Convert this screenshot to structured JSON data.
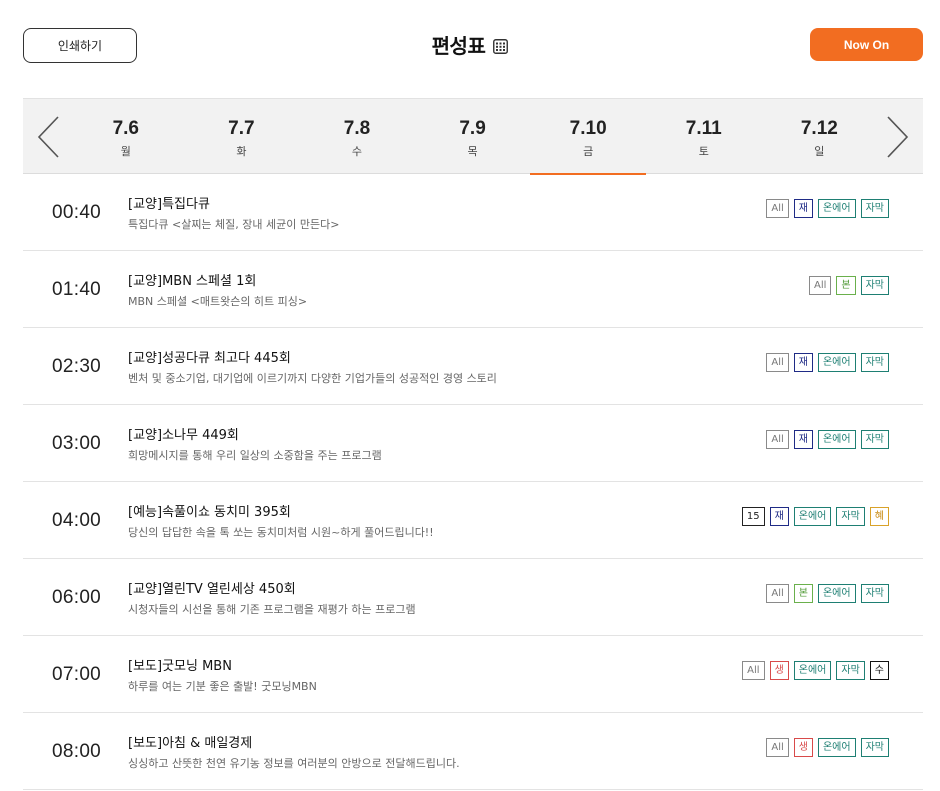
{
  "header": {
    "print_label": "인쇄하기",
    "title": "편성표",
    "now_on_label": "Now On",
    "calendar_icon": "calendar-icon",
    "accent_color": "#f26d21"
  },
  "dates": [
    {
      "num": "7.6",
      "day": "월",
      "active": false
    },
    {
      "num": "7.7",
      "day": "화",
      "active": false
    },
    {
      "num": "7.8",
      "day": "수",
      "active": false
    },
    {
      "num": "7.9",
      "day": "목",
      "active": false
    },
    {
      "num": "7.10",
      "day": "금",
      "active": true
    },
    {
      "num": "7.11",
      "day": "토",
      "active": false
    },
    {
      "num": "7.12",
      "day": "일",
      "active": false
    }
  ],
  "programs": [
    {
      "time": "00:40",
      "title": "[교양]특집다큐",
      "desc": "특집다큐 <살찌는 체질, 장내 세균이 만든다>",
      "badges": [
        {
          "t": "All",
          "k": "all"
        },
        {
          "t": "재",
          "k": "re"
        },
        {
          "t": "온에어",
          "k": "onair"
        },
        {
          "t": "자막",
          "k": "sub"
        }
      ]
    },
    {
      "time": "01:40",
      "title": "[교양]MBN 스페셜 1회",
      "desc": "MBN 스페셜 <매트왓슨의 히트 피싱>",
      "badges": [
        {
          "t": "All",
          "k": "all"
        },
        {
          "t": "본",
          "k": "main"
        },
        {
          "t": "자막",
          "k": "sub"
        }
      ]
    },
    {
      "time": "02:30",
      "title": "[교양]성공다큐 최고다 445회",
      "desc": "벤처 및 중소기업, 대기업에 이르기까지 다양한 기업가들의 성공적인 경영 스토리",
      "badges": [
        {
          "t": "All",
          "k": "all"
        },
        {
          "t": "재",
          "k": "re"
        },
        {
          "t": "온에어",
          "k": "onair"
        },
        {
          "t": "자막",
          "k": "sub"
        }
      ]
    },
    {
      "time": "03:00",
      "title": "[교양]소나무 449회",
      "desc": "희망메시지를 통해 우리 일상의 소중함을 주는 프로그램",
      "badges": [
        {
          "t": "All",
          "k": "all"
        },
        {
          "t": "재",
          "k": "re"
        },
        {
          "t": "온에어",
          "k": "onair"
        },
        {
          "t": "자막",
          "k": "sub"
        }
      ]
    },
    {
      "time": "04:00",
      "title": "[예능]속풀이쇼 동치미 395회",
      "desc": "당신의 답답한 속을 톡 쏘는 동치미처럼 시원~하게 풀어드립니다!!",
      "badges": [
        {
          "t": "15",
          "k": "15"
        },
        {
          "t": "재",
          "k": "re"
        },
        {
          "t": "온에어",
          "k": "onair"
        },
        {
          "t": "자막",
          "k": "sub"
        },
        {
          "t": "혜",
          "k": "benefit"
        }
      ]
    },
    {
      "time": "06:00",
      "title": "[교양]열린TV 열린세상 450회",
      "desc": "시청자들의 시선을 통해 기존 프로그램을 재평가 하는 프로그램",
      "badges": [
        {
          "t": "All",
          "k": "all"
        },
        {
          "t": "본",
          "k": "main"
        },
        {
          "t": "온에어",
          "k": "onair"
        },
        {
          "t": "자막",
          "k": "sub"
        }
      ]
    },
    {
      "time": "07:00",
      "title": "[보도]굿모닝 MBN",
      "desc": "하루를 여는 기분 좋은 출발! 굿모닝MBN",
      "badges": [
        {
          "t": "All",
          "k": "all"
        },
        {
          "t": "생",
          "k": "live"
        },
        {
          "t": "온에어",
          "k": "onair"
        },
        {
          "t": "자막",
          "k": "sub"
        },
        {
          "t": "수",
          "k": "su"
        }
      ]
    },
    {
      "time": "08:00",
      "title": "[보도]아침 & 매일경제",
      "desc": "싱싱하고 산뜻한 천연 유기농 정보를 여러분의 안방으로 전달해드립니다.",
      "badges": [
        {
          "t": "All",
          "k": "all"
        },
        {
          "t": "생",
          "k": "live"
        },
        {
          "t": "온에어",
          "k": "onair"
        },
        {
          "t": "자막",
          "k": "sub"
        }
      ]
    }
  ]
}
